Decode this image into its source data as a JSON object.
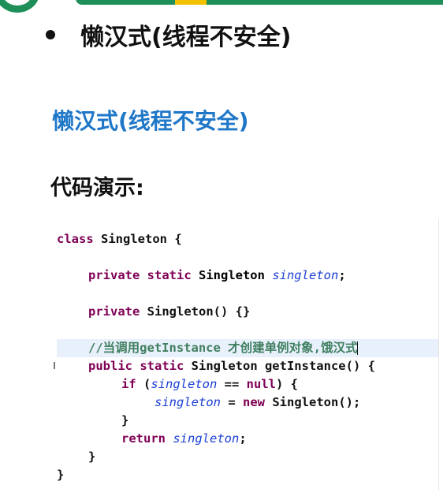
{
  "bullet": {
    "text": "懒汉式(线程不安全)"
  },
  "subtitle": "懒汉式(线程不安全)",
  "demo_label": "代码演示:",
  "code": {
    "l1_kw": "class",
    "l1_rest": " Singleton {",
    "l2_kw": "private static",
    "l2_type": " Singleton ",
    "l2_field": "singleton",
    "l2_end": ";",
    "l3_kw": "private",
    "l3_rest": " Singleton() {}",
    "l4_comment": "//当调用getInstance 才创建单例对象,饿汉式",
    "l5_kw": "public static",
    "l5_rest": " Singleton getInstance() {",
    "l6_kw": "if",
    "l6_open": " (",
    "l6_field": "singleton",
    "l6_op": " == ",
    "l6_null": "null",
    "l6_end": ") {",
    "l7_field": "singleton",
    "l7_op": " = ",
    "l7_new": "new",
    "l7_rest": " Singleton();",
    "l8_brace": "}",
    "l9_kw": "return",
    "l9_space": " ",
    "l9_field": "singleton",
    "l9_end": ";",
    "l10_brace": "}",
    "l11_brace": "}"
  },
  "colors": {
    "subtitle": "#1f77c8",
    "keyword": "#7f0055",
    "field": "#1c3fd4",
    "comment": "#3f7f5f",
    "highlight": "#e8f0fb",
    "header": "#1f8f5a"
  }
}
